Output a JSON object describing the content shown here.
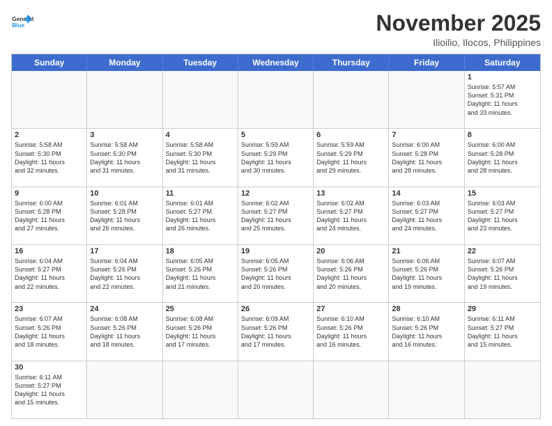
{
  "header": {
    "logo_general": "General",
    "logo_blue": "Blue",
    "month_title": "November 2025",
    "location": "Ilioilio, Ilocos, Philippines"
  },
  "days_of_week": [
    "Sunday",
    "Monday",
    "Tuesday",
    "Wednesday",
    "Thursday",
    "Friday",
    "Saturday"
  ],
  "weeks": [
    [
      {
        "day": "",
        "text": ""
      },
      {
        "day": "",
        "text": ""
      },
      {
        "day": "",
        "text": ""
      },
      {
        "day": "",
        "text": ""
      },
      {
        "day": "",
        "text": ""
      },
      {
        "day": "",
        "text": ""
      },
      {
        "day": "1",
        "text": "Sunrise: 5:57 AM\nSunset: 5:31 PM\nDaylight: 11 hours\nand 33 minutes."
      }
    ],
    [
      {
        "day": "2",
        "text": "Sunrise: 5:58 AM\nSunset: 5:30 PM\nDaylight: 11 hours\nand 32 minutes."
      },
      {
        "day": "3",
        "text": "Sunrise: 5:58 AM\nSunset: 5:30 PM\nDaylight: 11 hours\nand 31 minutes."
      },
      {
        "day": "4",
        "text": "Sunrise: 5:58 AM\nSunset: 5:30 PM\nDaylight: 11 hours\nand 31 minutes."
      },
      {
        "day": "5",
        "text": "Sunrise: 5:59 AM\nSunset: 5:29 PM\nDaylight: 11 hours\nand 30 minutes."
      },
      {
        "day": "6",
        "text": "Sunrise: 5:59 AM\nSunset: 5:29 PM\nDaylight: 11 hours\nand 29 minutes."
      },
      {
        "day": "7",
        "text": "Sunrise: 6:00 AM\nSunset: 5:28 PM\nDaylight: 11 hours\nand 28 minutes."
      },
      {
        "day": "8",
        "text": "Sunrise: 6:00 AM\nSunset: 5:28 PM\nDaylight: 11 hours\nand 28 minutes."
      }
    ],
    [
      {
        "day": "9",
        "text": "Sunrise: 6:00 AM\nSunset: 5:28 PM\nDaylight: 11 hours\nand 27 minutes."
      },
      {
        "day": "10",
        "text": "Sunrise: 6:01 AM\nSunset: 5:28 PM\nDaylight: 11 hours\nand 26 minutes."
      },
      {
        "day": "11",
        "text": "Sunrise: 6:01 AM\nSunset: 5:27 PM\nDaylight: 11 hours\nand 26 minutes."
      },
      {
        "day": "12",
        "text": "Sunrise: 6:02 AM\nSunset: 5:27 PM\nDaylight: 11 hours\nand 25 minutes."
      },
      {
        "day": "13",
        "text": "Sunrise: 6:02 AM\nSunset: 5:27 PM\nDaylight: 11 hours\nand 24 minutes."
      },
      {
        "day": "14",
        "text": "Sunrise: 6:03 AM\nSunset: 5:27 PM\nDaylight: 11 hours\nand 24 minutes."
      },
      {
        "day": "15",
        "text": "Sunrise: 6:03 AM\nSunset: 5:27 PM\nDaylight: 11 hours\nand 23 minutes."
      }
    ],
    [
      {
        "day": "16",
        "text": "Sunrise: 6:04 AM\nSunset: 5:27 PM\nDaylight: 11 hours\nand 22 minutes."
      },
      {
        "day": "17",
        "text": "Sunrise: 6:04 AM\nSunset: 5:26 PM\nDaylight: 11 hours\nand 22 minutes."
      },
      {
        "day": "18",
        "text": "Sunrise: 6:05 AM\nSunset: 5:26 PM\nDaylight: 11 hours\nand 21 minutes."
      },
      {
        "day": "19",
        "text": "Sunrise: 6:05 AM\nSunset: 5:26 PM\nDaylight: 11 hours\nand 20 minutes."
      },
      {
        "day": "20",
        "text": "Sunrise: 6:06 AM\nSunset: 5:26 PM\nDaylight: 11 hours\nand 20 minutes."
      },
      {
        "day": "21",
        "text": "Sunrise: 6:06 AM\nSunset: 5:26 PM\nDaylight: 11 hours\nand 19 minutes."
      },
      {
        "day": "22",
        "text": "Sunrise: 6:07 AM\nSunset: 5:26 PM\nDaylight: 11 hours\nand 19 minutes."
      }
    ],
    [
      {
        "day": "23",
        "text": "Sunrise: 6:07 AM\nSunset: 5:26 PM\nDaylight: 11 hours\nand 18 minutes."
      },
      {
        "day": "24",
        "text": "Sunrise: 6:08 AM\nSunset: 5:26 PM\nDaylight: 11 hours\nand 18 minutes."
      },
      {
        "day": "25",
        "text": "Sunrise: 6:08 AM\nSunset: 5:26 PM\nDaylight: 11 hours\nand 17 minutes."
      },
      {
        "day": "26",
        "text": "Sunrise: 6:09 AM\nSunset: 5:26 PM\nDaylight: 11 hours\nand 17 minutes."
      },
      {
        "day": "27",
        "text": "Sunrise: 6:10 AM\nSunset: 5:26 PM\nDaylight: 11 hours\nand 16 minutes."
      },
      {
        "day": "28",
        "text": "Sunrise: 6:10 AM\nSunset: 5:26 PM\nDaylight: 11 hours\nand 16 minutes."
      },
      {
        "day": "29",
        "text": "Sunrise: 6:11 AM\nSunset: 5:27 PM\nDaylight: 11 hours\nand 15 minutes."
      }
    ],
    [
      {
        "day": "30",
        "text": "Sunrise: 6:11 AM\nSunset: 5:27 PM\nDaylight: 11 hours\nand 15 minutes."
      },
      {
        "day": "",
        "text": ""
      },
      {
        "day": "",
        "text": ""
      },
      {
        "day": "",
        "text": ""
      },
      {
        "day": "",
        "text": ""
      },
      {
        "day": "",
        "text": ""
      },
      {
        "day": "",
        "text": ""
      }
    ]
  ]
}
